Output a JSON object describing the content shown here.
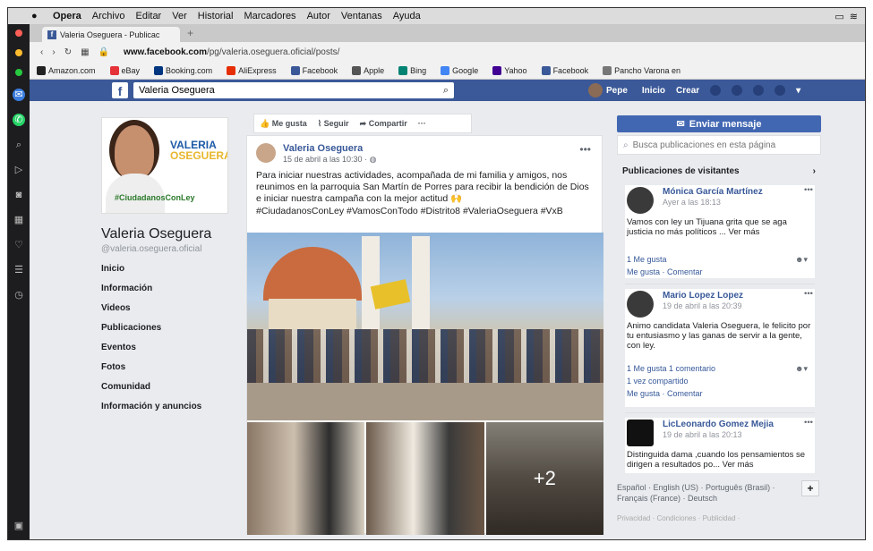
{
  "menubar": {
    "apple": "",
    "items": [
      "Opera",
      "Archivo",
      "Editar",
      "Ver",
      "Historial",
      "Marcadores",
      "Autor",
      "Ventanas",
      "Ayuda"
    ]
  },
  "tab": {
    "title": "Valeria Oseguera - Publicac"
  },
  "address": {
    "url_host": "www.facebook.com",
    "url_path": "/pg/valeria.oseguera.oficial/posts/"
  },
  "bookmarks": [
    {
      "label": "Amazon.com",
      "color": "#222"
    },
    {
      "label": "eBay",
      "color": "#e53238"
    },
    {
      "label": "Booking.com",
      "color": "#003580"
    },
    {
      "label": "AliExpress",
      "color": "#e62e04"
    },
    {
      "label": "Facebook",
      "color": "#3b5998"
    },
    {
      "label": "Apple",
      "color": "#555"
    },
    {
      "label": "Bing",
      "color": "#008373"
    },
    {
      "label": "Google",
      "color": "#4285f4"
    },
    {
      "label": "Yahoo",
      "color": "#410093"
    },
    {
      "label": "Facebook",
      "color": "#3b5998"
    },
    {
      "label": "Pancho Varona en",
      "color": "#777"
    }
  ],
  "fbbar": {
    "search_value": "Valeria Oseguera",
    "user": "Pepe",
    "nav": [
      "Inicio",
      "Crear"
    ]
  },
  "profile": {
    "logo_line1": "VALERIA",
    "logo_line2": "OSEGUERA",
    "logo_tag": "#CiudadanosConLey",
    "name": "Valeria Oseguera",
    "handle": "@valeria.oseguera.oficial",
    "nav": [
      "Inicio",
      "Información",
      "Videos",
      "Publicaciones",
      "Eventos",
      "Fotos",
      "Comunidad",
      "Información y anuncios"
    ]
  },
  "actions": {
    "like": "Me gusta",
    "follow": "Seguir",
    "share": "Compartir",
    "more": "···"
  },
  "post": {
    "author": "Valeria Oseguera",
    "date": "15 de abril a las 10:30 ·",
    "text": "Para iniciar nuestras actividades, acompañada de mi familia y amigos, nos reunimos en la parroquia San Martín de Porres para recibir la bendición de Dios e iniciar nuestra campaña con la mejor actitud 🙌",
    "tags": "#CiudadanosConLey #VamosConTodo #Distrito8 #ValeriaOseguera #VxB",
    "more_photos": "+2"
  },
  "right": {
    "send_message": "Enviar mensaje",
    "search_placeholder": "Busca publicaciones en esta página",
    "visitor_posts_title": "Publicaciones de visitantes",
    "visitor_posts": [
      {
        "name": "Mónica García Martínez",
        "date": "Ayer a las 18:13",
        "text": "Vamos con ley un Tijuana grita que se aga justicia no más políticos ... Ver más",
        "likes": "1 Me gusta",
        "actions": "Me gusta · Comentar"
      },
      {
        "name": "Mario Lopez Lopez",
        "date": "19 de abril a las 20:39",
        "text": "Animo candidata Valeria Oseguera, le felicito por tu entusiasmo y las ganas de servir a la gente, con ley.",
        "likes": "1 Me gusta   1 comentario",
        "shared": "1 vez compartido",
        "actions": "Me gusta · Comentar"
      },
      {
        "name": "LicLeonardo Gomez Mejia",
        "date": "19 de abril a las 20:13",
        "text": "Distinguida dama ,cuando los pensamientos se dirigen a resultados po... Ver más"
      }
    ],
    "languages": "Español · English (US) · Português (Brasil) · Français (France) · Deutsch",
    "lang_plus": "+",
    "footer": "Privacidad · Condiciones · Publicidad ·"
  },
  "colors": {
    "fb_blue": "#3b5998",
    "button_blue": "#4267b2"
  }
}
